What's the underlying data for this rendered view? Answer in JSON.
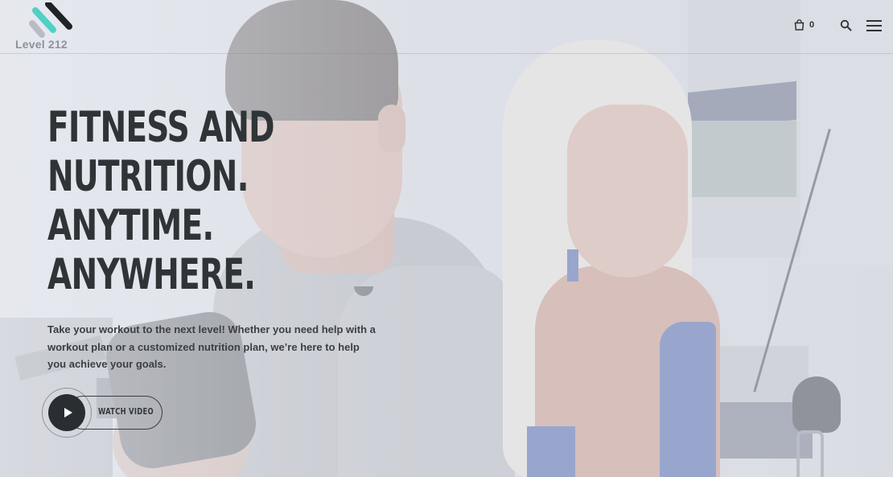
{
  "brand": {
    "logo_text": "Level 212",
    "accent_color": "#4fd1c5"
  },
  "header": {
    "cart_count": "0",
    "icons": {
      "cart": "shopping-bag-icon",
      "search": "search-icon",
      "menu": "hamburger-menu-icon"
    }
  },
  "hero": {
    "headline_lines": [
      "FITNESS AND",
      "NUTRITION.",
      "ANYTIME.",
      "ANYWHERE."
    ],
    "subtext": "Take your workout to the next level! Whether you need help with a workout plan or a customized nutrition plan, we’re here to help you achieve your goals.",
    "video_button_label": "WATCH VIDEO"
  }
}
